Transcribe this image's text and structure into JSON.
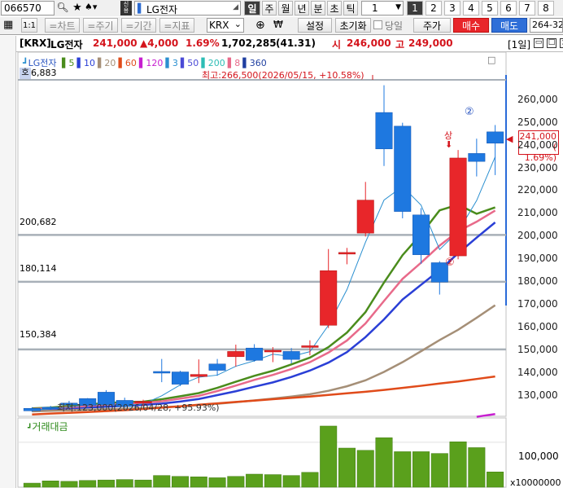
{
  "toolbar": {
    "code": "066570",
    "name": "LG전자",
    "period_chips": [
      "=차트",
      "=주기",
      "=기간",
      "=지표"
    ],
    "periods": [
      "일",
      "주",
      "월",
      "년",
      "분",
      "초",
      "틱"
    ],
    "period_count": "1",
    "pages": [
      "1",
      "2",
      "3",
      "4",
      "5",
      "6",
      "7",
      "8"
    ],
    "active_page": "1"
  },
  "toolbar2": {
    "ratio_label": "1:1",
    "market": "KRX",
    "settings": "설정",
    "reset": "초기화",
    "same_day": "당일",
    "stock_price": "주가",
    "buy": "매수",
    "sell": "매도",
    "account": "264-32"
  },
  "header": {
    "market": "[KRX]",
    "name": "LG전자",
    "price": "241,000",
    "change": "▲4,000",
    "change_pct": "1.69%",
    "volume": "1,702,285",
    "volume_ratio": "(41.31)",
    "open_label": "시",
    "open": "246,000",
    "high_label": "고",
    "high": "249,000",
    "period_tag": "[1일]"
  },
  "legend": {
    "stock": "LG전자",
    "ma": [
      {
        "n": "5",
        "color": "#4a8c1c"
      },
      {
        "n": "10",
        "color": "#2a3fd6"
      },
      {
        "n": "20",
        "color": "#a58f77"
      },
      {
        "n": "60",
        "color": "#e04b1a"
      },
      {
        "n": "120",
        "color": "#c71fd0"
      },
      {
        "n": "3",
        "color": "#2a8fd0"
      },
      {
        "n": "50",
        "color": "#4a4ad6"
      },
      {
        "n": "200",
        "color": "#2dbdb5"
      },
      {
        "n": "8",
        "color": "#e86a8a"
      },
      {
        "n": "360",
        "color": "#1f3fa0"
      }
    ]
  },
  "annotations": {
    "top_left_value": "6,883",
    "top_left_badge": "호",
    "high_note": "최고:266,500(2026/05/15, +10.58%)",
    "low_note": "최저:123,000(2026/04/28, +95.93%)",
    "sang": "상",
    "circled2": "②"
  },
  "hlines": [
    {
      "label": "200,682",
      "value": 200682
    },
    {
      "label": "180,114",
      "value": 180114
    },
    {
      "label": "150,384",
      "value": 150384
    }
  ],
  "price_box": {
    "price": "241,000",
    "pct": "( 1.69%)"
  },
  "volume_panel": {
    "title": "거래대금",
    "tick": "100,000",
    "unit": "x10000000"
  },
  "chart_data": {
    "type": "candlestick",
    "title": "LG전자",
    "y_ticks": [
      130000,
      140000,
      150000,
      160000,
      170000,
      180000,
      190000,
      200000,
      210000,
      220000,
      230000,
      240000,
      250000,
      260000
    ],
    "y_tick_labels": [
      "130,000",
      "140,000",
      "150,000",
      "160,000",
      "170,000",
      "180,000",
      "190,000",
      "200,000",
      "210,000",
      "220,000",
      "230,000",
      "240,000",
      "250,000",
      "260,000"
    ],
    "ylim": [
      121000,
      271000
    ],
    "candles": [
      {
        "o": 124500,
        "c": 123400,
        "h": 125000,
        "l": 123000
      },
      {
        "o": 125000,
        "c": 124600,
        "h": 125600,
        "l": 124000
      },
      {
        "o": 126800,
        "c": 126000,
        "h": 127800,
        "l": 125000
      },
      {
        "o": 128800,
        "c": 125800,
        "h": 129000,
        "l": 125000
      },
      {
        "o": 131600,
        "c": 126300,
        "h": 132500,
        "l": 124800
      },
      {
        "o": 128000,
        "c": 125300,
        "h": 129200,
        "l": 124800
      },
      {
        "o": 126800,
        "c": 127600,
        "h": 128300,
        "l": 125500
      },
      {
        "o": 140700,
        "c": 140000,
        "h": 146200,
        "l": 136000
      },
      {
        "o": 140500,
        "c": 135100,
        "h": 141000,
        "l": 134300
      },
      {
        "o": 138500,
        "c": 139400,
        "h": 146000,
        "l": 135600
      },
      {
        "o": 144000,
        "c": 141200,
        "h": 146200,
        "l": 138800
      },
      {
        "o": 147200,
        "c": 149500,
        "h": 152500,
        "l": 142800
      },
      {
        "o": 151000,
        "c": 145600,
        "h": 152700,
        "l": 145000
      },
      {
        "o": 149500,
        "c": 150000,
        "h": 151400,
        "l": 144800
      },
      {
        "o": 149500,
        "c": 146000,
        "h": 151000,
        "l": 144300
      },
      {
        "o": 152000,
        "c": 152000,
        "h": 154400,
        "l": 147800
      },
      {
        "o": 161000,
        "c": 185000,
        "h": 194500,
        "l": 159800
      },
      {
        "o": 192500,
        "c": 193000,
        "h": 195000,
        "l": 187800
      },
      {
        "o": 201500,
        "c": 216000,
        "h": 224000,
        "l": 200000
      },
      {
        "o": 254500,
        "c": 238500,
        "h": 266500,
        "l": 231000
      },
      {
        "o": 248500,
        "c": 211000,
        "h": 250000,
        "l": 208000
      },
      {
        "o": 209500,
        "c": 192000,
        "h": 212500,
        "l": 188000
      },
      {
        "o": 188500,
        "c": 180000,
        "h": 189200,
        "l": 174500
      },
      {
        "o": 191500,
        "c": 234500,
        "h": 238000,
        "l": 190000
      },
      {
        "o": 236500,
        "c": 233000,
        "h": 243000,
        "l": 226400
      },
      {
        "o": 246000,
        "c": 241000,
        "h": 249000,
        "l": 227000
      }
    ],
    "ma_lines": [
      {
        "name": "5",
        "color": "#4a8c1c",
        "values": [
          124500,
          124800,
          125500,
          126200,
          126800,
          127200,
          127400,
          128500,
          129800,
          131200,
          133500,
          136200,
          138800,
          141000,
          143800,
          146800,
          151400,
          157800,
          166800,
          179800,
          191800,
          201000,
          211500,
          214000,
          210000,
          212800
        ]
      },
      {
        "name": "10",
        "color": "#2a3fd6",
        "values": [
          124000,
          124200,
          124500,
          124900,
          125200,
          125600,
          126000,
          126600,
          127500,
          128600,
          130300,
          132000,
          134000,
          135900,
          138300,
          141100,
          144600,
          149200,
          155800,
          163600,
          172300,
          178800,
          185200,
          192600,
          199500,
          206200
        ]
      },
      {
        "name": "8",
        "color": "#e86a8a",
        "values": [
          124200,
          124500,
          125000,
          125600,
          126100,
          126500,
          126900,
          127600,
          128800,
          130000,
          132100,
          134500,
          137000,
          139200,
          141800,
          144800,
          149000,
          154300,
          161800,
          171700,
          181400,
          188500,
          196000,
          202300,
          206500,
          211400
        ]
      },
      {
        "name": "3",
        "color": "#2a8fd0",
        "values": [
          123800,
          124200,
          125000,
          126200,
          126100,
          125800,
          126400,
          130000,
          134800,
          138200,
          139100,
          143000,
          145400,
          148300,
          147300,
          149400,
          161000,
          176700,
          197500,
          216000,
          222000,
          213800,
          194300,
          202200,
          215800,
          235000
        ]
      },
      {
        "name": "20",
        "color": "#a58f77",
        "values": [
          123200,
          123400,
          123600,
          123900,
          124100,
          124300,
          124600,
          125000,
          125400,
          125900,
          126500,
          127200,
          128000,
          128800,
          129700,
          130700,
          132200,
          134200,
          136800,
          140500,
          144800,
          149600,
          154500,
          159000,
          164300,
          169800
        ]
      },
      {
        "name": "60",
        "color": "#e04b1a",
        "values": [
          121800,
          122200,
          122500,
          122900,
          123300,
          123700,
          124200,
          124800,
          125400,
          126100,
          126700,
          127300,
          127900,
          128500,
          129100,
          129700,
          130400,
          131100,
          131800,
          132600,
          133500,
          134400,
          135400,
          136300,
          137400,
          138500
        ]
      },
      {
        "name": "120",
        "color": "#c71fd0",
        "values": [
          null,
          null,
          null,
          null,
          null,
          null,
          null,
          null,
          null,
          null,
          null,
          null,
          null,
          null,
          null,
          null,
          null,
          null,
          null,
          null,
          null,
          null,
          null,
          null,
          120800,
          122000
        ]
      }
    ],
    "volume": [
      0.9,
      1.4,
      1.3,
      1.5,
      1.6,
      1.7,
      1.6,
      2.6,
      2.4,
      2.3,
      2.1,
      2.4,
      2.9,
      2.8,
      2.6,
      3.3,
      13.6,
      8.7,
      8.2,
      11.0,
      7.9,
      7.9,
      7.5,
      10.1,
      8.8,
      3.4
    ],
    "volume_ylim": [
      0,
      14.5
    ],
    "volume_tick": 10
  }
}
